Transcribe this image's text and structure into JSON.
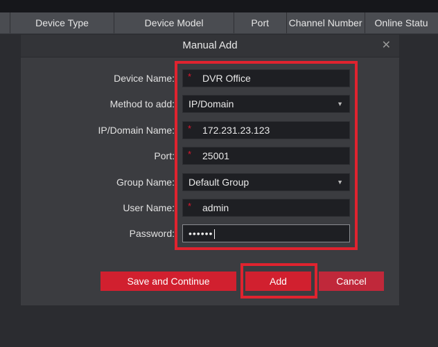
{
  "table_header": {
    "columns": [
      "Device Type",
      "Device Model",
      "Port",
      "Channel Number",
      "Online Statu"
    ]
  },
  "dialog": {
    "title": "Manual Add",
    "close_label": "✕",
    "fields": {
      "device_name": {
        "label": "Device Name:",
        "value": "DVR Office"
      },
      "method": {
        "label": "Method to add:",
        "value": "IP/Domain"
      },
      "ip_domain": {
        "label": "IP/Domain Name:",
        "value": "172.231.23.123"
      },
      "port": {
        "label": "Port:",
        "value": "25001"
      },
      "group": {
        "label": "Group Name:",
        "value": "Default Group"
      },
      "user": {
        "label": "User Name:",
        "value": "admin"
      },
      "password": {
        "label": "Password:",
        "value": "••••••"
      }
    },
    "required_mark": "*",
    "buttons": {
      "save_continue": "Save and Continue",
      "add": "Add",
      "cancel": "Cancel"
    }
  },
  "colors": {
    "accent_red": "#d1202f",
    "annotation_red": "#e0232f",
    "dialog_bg": "#3b3c40",
    "field_bg": "#1e1f23"
  },
  "icons": [
    "close-icon",
    "chevron-down-icon"
  ]
}
